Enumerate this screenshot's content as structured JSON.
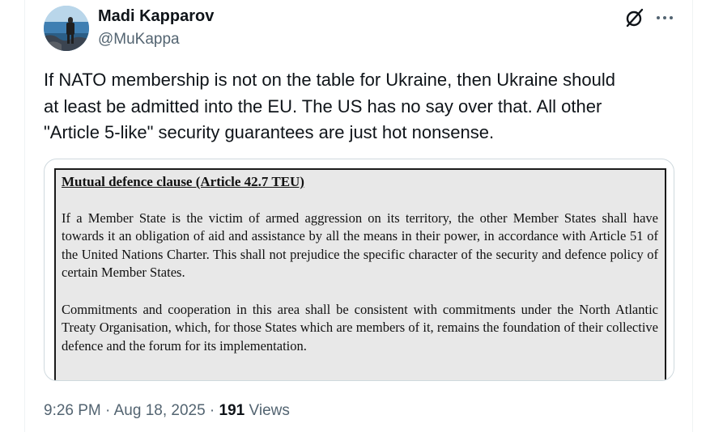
{
  "author": {
    "name": "Madi Kapparov",
    "handle": "@MuKappa"
  },
  "icons": {
    "grok": "grok-slash-circle-icon",
    "more": "more-horizontal-icon"
  },
  "tweet": {
    "text": "If NATO membership is not on the table for Ukraine, then Ukraine should\nat least be admitted into the EU. The US has no say over that. All other\n\"Article 5-like\" security guarantees are just hot nonsense."
  },
  "media_document": {
    "heading": "Mutual defence clause (Article 42.7 TEU)",
    "paragraphs": [
      "If a Member State is the victim of armed aggression on its territory, the other Member States shall have towards it an obligation of aid and assistance by all the means in their power, in accordance with Article 51 of the United Nations Charter. This shall not prejudice the specific character of the security and defence policy of certain Member States.",
      "Commitments and cooperation in this area shall be consistent with commitments under the North Atlantic Treaty Organisation, which, for those States which are members of it, remains the foundation of their collective defence and the forum for its implementation."
    ]
  },
  "meta": {
    "time": "9:26 PM",
    "separator": " · ",
    "date": "Aug 18, 2025",
    "views_count": "191",
    "views_label": " Views"
  },
  "colors": {
    "text_primary": "#0f1419",
    "text_secondary": "#536471",
    "border": "#cfd9de",
    "doc_background": "#e8e8e8"
  }
}
